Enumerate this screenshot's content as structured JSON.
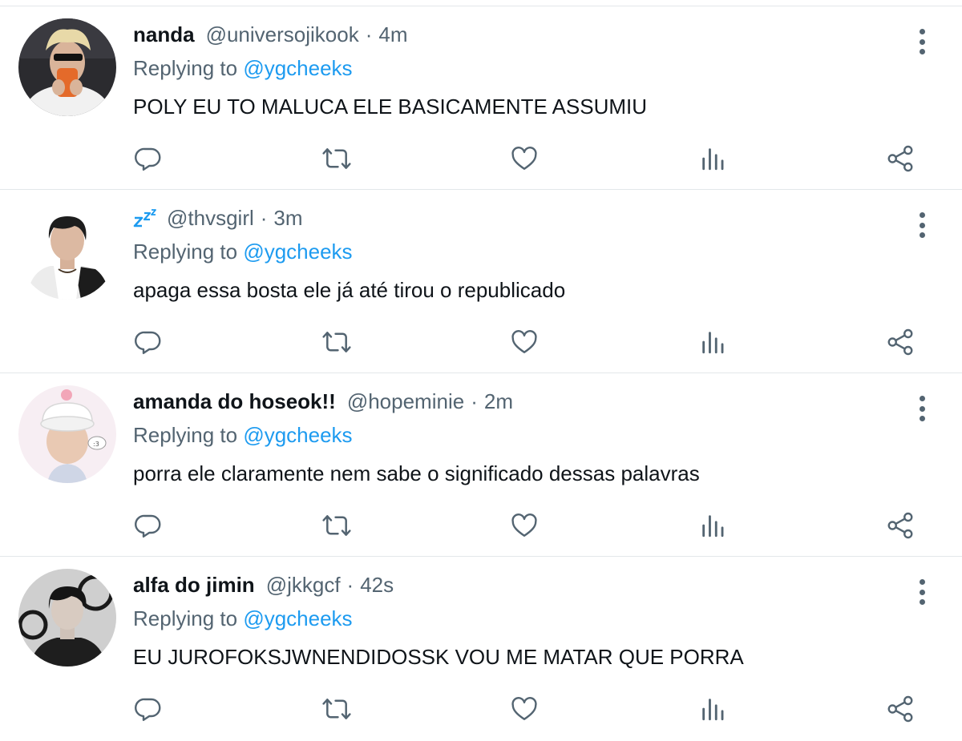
{
  "replying_prefix": "Replying to ",
  "tweets": [
    {
      "name": "nanda",
      "handle": "@universojikook",
      "separator": "·",
      "time": "4m",
      "reply_to": "@ygcheeks",
      "text": "POLY EU TO MALUCA ELE BASICAMENTE ASSUMIU"
    },
    {
      "name": "",
      "name_icon": "zzz-emoji-icon",
      "handle": "@thvsgirl",
      "separator": "·",
      "time": "3m",
      "reply_to": "@ygcheeks",
      "text": "apaga essa bosta ele já até tirou o republicado"
    },
    {
      "name": "amanda do hoseok!!",
      "handle": "@hopeminie",
      "separator": "·",
      "time": "2m",
      "reply_to": "@ygcheeks",
      "text": "porra ele claramente nem sabe o significado dessas palavras"
    },
    {
      "name": "alfa do jimin",
      "handle": "@jkkgcf",
      "separator": "·",
      "time": "42s",
      "reply_to": "@ygcheeks",
      "text": "EU JUROFOKSJWNENDIDOSSK VOU ME MATAR QUE PORRA"
    }
  ],
  "icons": {
    "reply": "reply-icon",
    "retweet": "retweet-icon",
    "like": "like-icon",
    "views": "views-icon",
    "share": "share-icon",
    "more": "more-icon"
  },
  "colors": {
    "secondary_text": "#536471",
    "mention": "#1d9bf0",
    "divider": "#e3e7ea",
    "primary_text": "#0f1419"
  }
}
